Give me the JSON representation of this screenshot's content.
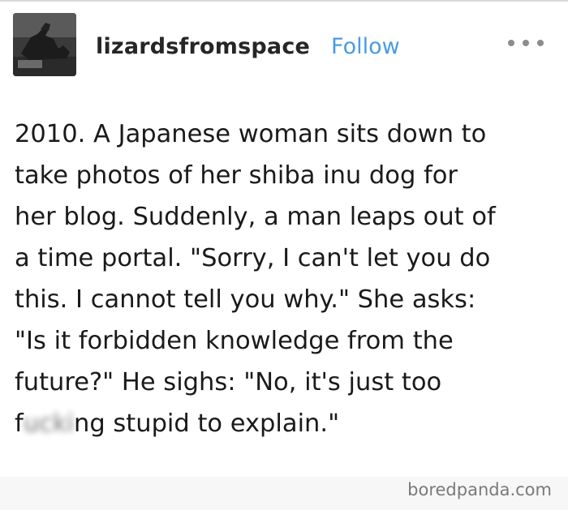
{
  "post": {
    "blog_name": "lizardsfromspace",
    "follow_label": "Follow",
    "more_icon": "more-horizontal-icon",
    "body_lines": [
      "2010. A Japanese woman sits down to",
      "take photos of her shiba inu dog for",
      "her blog. Suddenly, a man leaps out of",
      "a time portal. \"Sorry, I can't let you do",
      "this. I cannot tell you why.\" She asks:",
      "\"Is it forbidden knowledge from the",
      "future?\" He sighs: \"No, it's just too"
    ],
    "last_line": {
      "prefix": "f",
      "blurred": "ucki",
      "suffix": "ng stupid to explain.\""
    }
  },
  "watermark": {
    "text": "boredpanda.com"
  },
  "colors": {
    "follow_link": "#4a9be3",
    "text": "#1a1a1a",
    "watermark": "#7a7a7a"
  }
}
